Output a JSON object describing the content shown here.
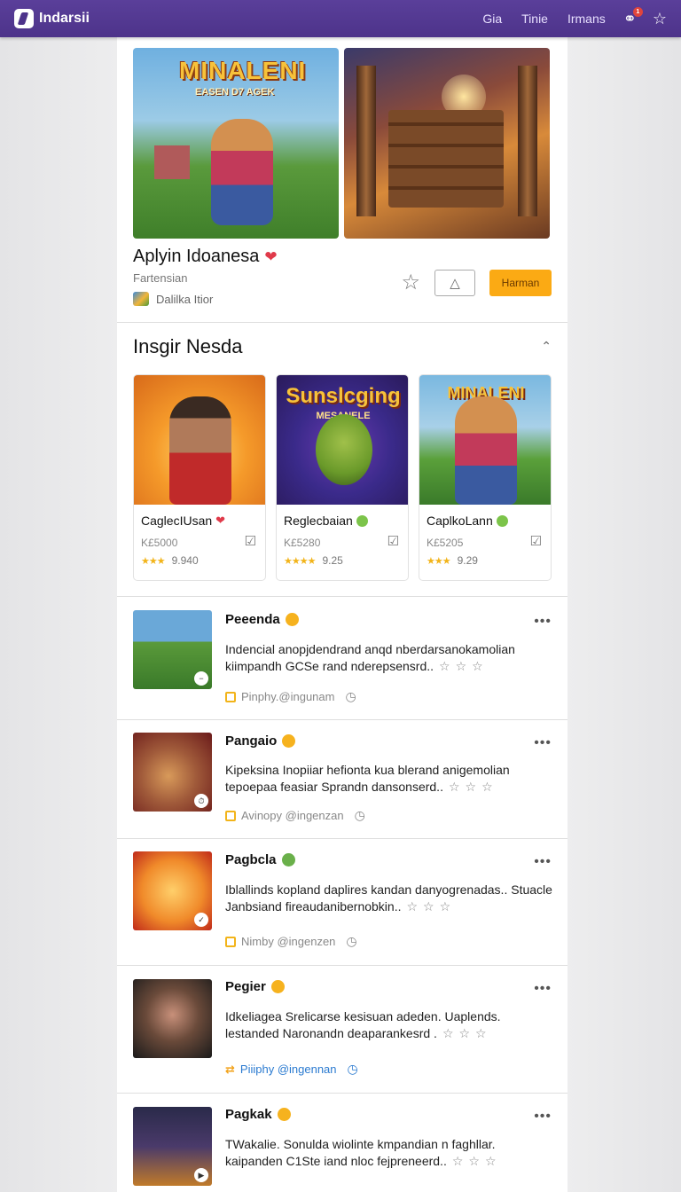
{
  "topbar": {
    "brand": "Indarsii",
    "nav": [
      "Gia",
      "Tinie",
      "Irmans"
    ],
    "notif_count": "1"
  },
  "hero": {
    "art_title": "MINALENI",
    "art_subtitle": "EASEN D7 AGEK",
    "title": "Aplyin Idoanesa",
    "subtitle": "Fartensian",
    "developer": "Dalilka Itior",
    "primary_button": "Harman"
  },
  "section": {
    "title": "Insgir Nesda"
  },
  "cards": [
    {
      "name": "CaglecIUsan",
      "price": "K£5000",
      "rating": "9.940",
      "stars": "★★★"
    },
    {
      "name": "Reglecbaian",
      "price": "K£5280",
      "rating": "9.25",
      "stars": "★★★★",
      "art_title": "Sunslcging",
      "art_subtitle": "MESANELE"
    },
    {
      "name": "CaplkoLann",
      "price": "K£5205",
      "rating": "9.29",
      "stars": "★★★",
      "art_title": "MINALENI"
    }
  ],
  "list": [
    {
      "title": "Peeenda",
      "desc": "Indencial anopjdendrand anqd nberdarsanokamolian kiimpandh GCSe rand nderepsensrd..",
      "meta": "Pinphy.@ingunam"
    },
    {
      "title": "Pangaio",
      "desc": "Kipeksina Inopiiar hefionta kua blerand anigemolian tepoepaa feasiar Sprandn dansonserd..",
      "meta": "Avinopy @ingenzan"
    },
    {
      "title": "Pagbcla",
      "desc": "Iblallinds kopland daplires kandan danyogrenadas.. Stuacle Janbsiand fireaudanibernobkin..",
      "meta": "Nimby @ingenzen"
    },
    {
      "title": "Pegier",
      "desc": "Idkeliagea Srelicarse kesisuan adeden. Uaplends. lestanded Naronandn deaparankesrd .",
      "meta": "Piiiphy @ingennan"
    },
    {
      "title": "Pagkak",
      "desc": "TWakalie. Sonulda wiolinte kmpandian n faghllar. kaipanden C1Ste iand nloc fejpreneerd..",
      "meta": ""
    }
  ]
}
